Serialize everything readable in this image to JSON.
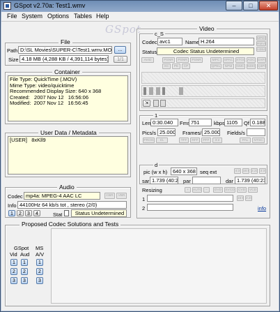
{
  "window": {
    "title": "GSpot v2.70a: Test1.wmv",
    "min": "–",
    "max": "□",
    "close": "✕"
  },
  "menu": [
    "File",
    "System",
    "Options",
    "Tables",
    "Help"
  ],
  "logo": "GSpot",
  "file": {
    "title": "File",
    "path_label": "Path",
    "path": "D:\\SL Movies\\SUPER-C\\Test1.wmv.MOV",
    "browse": "...",
    "size_label": "Size",
    "size": "4.18 MB (4,288 KB / 4,391,114 bytes)",
    "page": "1/1"
  },
  "container": {
    "title": "Container",
    "info": "File Type: QuickTime (.MOV)\nMime Type: video/quicktime\nRecommended Display Size: 640 x 368\nCreated:   2007 Nov 12   16:56:06\nModified:  2007 Nov 12   16:56:45"
  },
  "userdata": {
    "title": "User Data / Metadata",
    "text": "[USER]   8xKll9"
  },
  "audio": {
    "title": "Audio",
    "codec_label": "Codec",
    "codec": "mp4a: MPEG-4 AAC LC",
    "cbr": "CBR",
    "vbr": "VBR",
    "info_label": "Info",
    "info": "44100Hz  64 kb/s tot , stereo (2/0)",
    "stat_buttons": [
      "1",
      "2",
      "3",
      "4"
    ],
    "stat_label": "Stat",
    "status": "Status Undetermined"
  },
  "proposed": {
    "title": "Proposed Codec Solutions and Tests",
    "gspot_label": "GSpot",
    "ms_label": "MS",
    "vid": "Vid",
    "aud": "Aud",
    "av": "A/V",
    "rows": [
      "1",
      "2",
      "3"
    ]
  },
  "video": {
    "title": "Video",
    "cs_label": "c_S",
    "codec_label": "Codec",
    "codec": "avc1",
    "name_label": "Name",
    "name": "H.264",
    "status_label": "Status",
    "status": "Codec Status Undetermined",
    "side_tags": [
      "MPEG",
      "RMVB",
      "H264"
    ],
    "flags_row1": [
      "AVID",
      "PSNR",
      "PSNR",
      "PSNR",
      "MPC",
      "SPAC",
      "XTGO",
      "AOC",
      "DXFO"
    ],
    "flags_row2": [
      "XC",
      "PE",
      "CP",
      "QPEL",
      "NPM",
      "GMC",
      "NDIG",
      "Q3P0"
    ],
    "len_label": "Len",
    "len": "0:30.040",
    "fms_label": "Fms",
    "fms": "751",
    "kbps_label": "kbps",
    "kbps": "1105",
    "qf_label": "Qf",
    "qf": "0.188",
    "pics_label": "Pics/s",
    "pics": "25.000",
    "frames_label": "Frames/s",
    "frames": "25.000",
    "fields_label": "Fields/s",
    "fields": "",
    "frame_flags": [
      "PROG",
      "I/L",
      "TFF",
      "RFF",
      "PFF",
      "3:2",
      "PAL",
      "NTSC"
    ],
    "pic_label": "pic (w x h)",
    "pic": "640 x 368",
    "seq_label": "seq ext",
    "ar_buttons": [
      "4:3",
      "16:9",
      "2.21",
      "3:3"
    ],
    "sar_label": "sar",
    "sar": "1.739 (40:23)",
    "par_label": "par",
    "par": "",
    "dar_label": "dar",
    "dar": "1.739 (40:23)",
    "resizing_label": "Resizing",
    "resize_buttons": [
      "+",
      "AUTO",
      "–",
      "DVD",
      "SVCD",
      "CVD",
      "VCD"
    ],
    "row1": "1",
    "row2": "2",
    "info_link": "info",
    "marker_d": "d"
  }
}
